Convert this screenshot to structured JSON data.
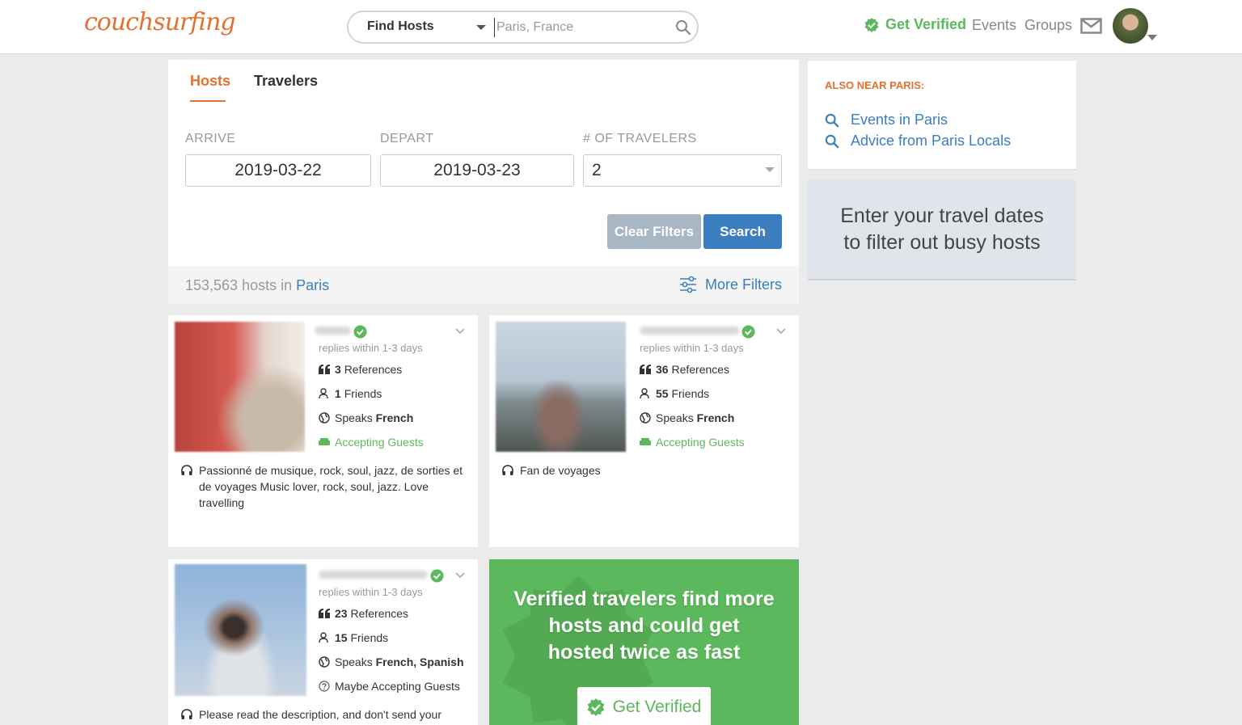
{
  "header": {
    "logo": "couchsurfing",
    "search_type": "Find Hosts",
    "search_placeholder": "Paris, France",
    "get_verified": "Get Verified",
    "events": "Events",
    "groups": "Groups"
  },
  "tabs": {
    "hosts": "Hosts",
    "travelers": "Travelers"
  },
  "filters": {
    "arrive_label": "ARRIVE",
    "arrive_value": "2019-03-22",
    "depart_label": "DEPART",
    "depart_value": "2019-03-23",
    "travelers_label": "# OF TRAVELERS",
    "travelers_value": "2",
    "clear_label": "Clear Filters",
    "search_label": "Search",
    "results_count": "153,563 hosts in",
    "results_city": "Paris",
    "more_filters": "More Filters"
  },
  "near": {
    "title": "ALSO NEAR PARIS:",
    "links": [
      "Events in Paris",
      "Advice from Paris Locals"
    ]
  },
  "dates_prompt": "Enter your travel dates to filter out busy hosts",
  "hosts": [
    {
      "replies": "replies within 1-3 days",
      "references_count": "3",
      "references_label": "References",
      "friends_count": "1",
      "friends_label": "Friends",
      "speaks_label": "Speaks",
      "languages": "French",
      "status": "Accepting Guests",
      "about": "Passionné de musique, rock, soul, jazz, de sorties et de voyages Music lover, rock, soul, jazz. Love travelling"
    },
    {
      "replies": "replies within 1-3 days",
      "references_count": "36",
      "references_label": "References",
      "friends_count": "55",
      "friends_label": "Friends",
      "speaks_label": "Speaks",
      "languages": "French",
      "status": "Accepting Guests",
      "about": "Fan de voyages"
    },
    {
      "replies": "replies within 1-3 days",
      "references_count": "23",
      "references_label": "References",
      "friends_count": "15",
      "friends_label": "Friends",
      "speaks_label": "Speaks",
      "languages": "French, Spanish",
      "status": "Maybe Accepting Guests",
      "about": "Please read the description, and don't send your"
    }
  ],
  "promo": {
    "text": "Verified travelers find more hosts and could get hosted twice as fast",
    "button": "Get Verified"
  },
  "colors": {
    "brand_orange": "#e2712f",
    "link_blue": "#3a7ebf",
    "verified_green": "#5cb85c"
  },
  "icons": [
    "search-icon",
    "verified-check-icon",
    "mail-icon",
    "filter-sliders-icon",
    "quote-icon",
    "friends-icon",
    "globe-icon",
    "couch-icon",
    "help-circle-icon",
    "headphones-icon",
    "chevron-down-icon"
  ]
}
